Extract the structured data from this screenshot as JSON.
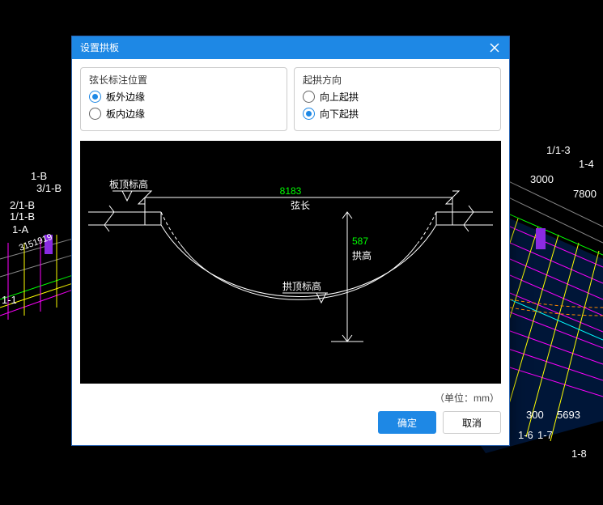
{
  "dialog": {
    "title": "设置拱板",
    "close_label": "close"
  },
  "chord_panel": {
    "title": "弦长标注位置",
    "options": [
      "板外边缘",
      "板内边缘"
    ],
    "selected_index": 0
  },
  "arch_panel": {
    "title": "起拱方向",
    "options": [
      "向上起拱",
      "向下起拱"
    ],
    "selected_index": 1
  },
  "diagram": {
    "top_label": "板顶标高",
    "chord_value": "8183",
    "chord_label": "弦长",
    "arch_value": "587",
    "arch_label": "拱高",
    "crown_label": "拱顶标高"
  },
  "footer": {
    "unit_text": "（单位：mm）",
    "ok": "确定",
    "cancel": "取消"
  },
  "background_labels": {
    "l1": "1-1",
    "l2": "1-A",
    "l3": "1/1-B",
    "l4": "2/1-B",
    "l5": "3/1-B",
    "l6": "1-B",
    "r1": "1/1-3",
    "r2": "1-4",
    "r3": "3000",
    "r4": "7800",
    "r5": "300",
    "r6": "5693",
    "r7": "1-7",
    "r8": "1-8",
    "r9": "1-6",
    "lnum": "3151919"
  },
  "colors": {
    "accent": "#1e88e5",
    "diagram_green": "#00ff00",
    "diagram_white": "#ffffff"
  }
}
